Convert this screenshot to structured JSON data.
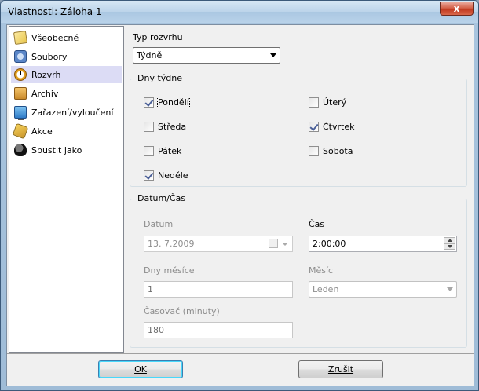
{
  "window": {
    "title": "Vlastnosti: Záloha 1",
    "close_glyph": "x"
  },
  "nav": {
    "items": [
      {
        "label": "Všeobecné",
        "icon": "document-icon",
        "selected": false
      },
      {
        "label": "Soubory",
        "icon": "files-icon",
        "selected": false
      },
      {
        "label": "Rozvrh",
        "icon": "clock-icon",
        "selected": true
      },
      {
        "label": "Archiv",
        "icon": "archive-icon",
        "selected": false
      },
      {
        "label": "Zařazení/vyloučení",
        "icon": "monitor-icon",
        "selected": false
      },
      {
        "label": "Akce",
        "icon": "lightning-icon",
        "selected": false
      },
      {
        "label": "Spustit jako",
        "icon": "user-icon",
        "selected": false
      }
    ]
  },
  "schedule": {
    "type_label": "Typ rozvrhu",
    "type_value": "Týdně"
  },
  "days": {
    "group_title": "Dny týdne",
    "monday": {
      "label": "Pondělí",
      "checked": true
    },
    "tuesday": {
      "label": "Úterý",
      "checked": false
    },
    "wednesday": {
      "label": "Středa",
      "checked": false
    },
    "thursday": {
      "label": "Čtvrtek",
      "checked": true
    },
    "friday": {
      "label": "Pátek",
      "checked": false
    },
    "saturday": {
      "label": "Sobota",
      "checked": false
    },
    "sunday": {
      "label": "Neděle",
      "checked": true
    }
  },
  "datetime": {
    "group_title": "Datum/Čas",
    "date_label": "Datum",
    "date_value": "13.  7.2009",
    "time_label": "Čas",
    "time_value": "2:00:00",
    "days_of_month_label": "Dny měsíce",
    "days_of_month_value": "1",
    "month_label": "Měsíc",
    "month_value": "Leden",
    "timer_label": "Časovač (minuty)",
    "timer_value": "180"
  },
  "buttons": {
    "ok_label": "OK",
    "cancel_label": "Zrušit"
  }
}
